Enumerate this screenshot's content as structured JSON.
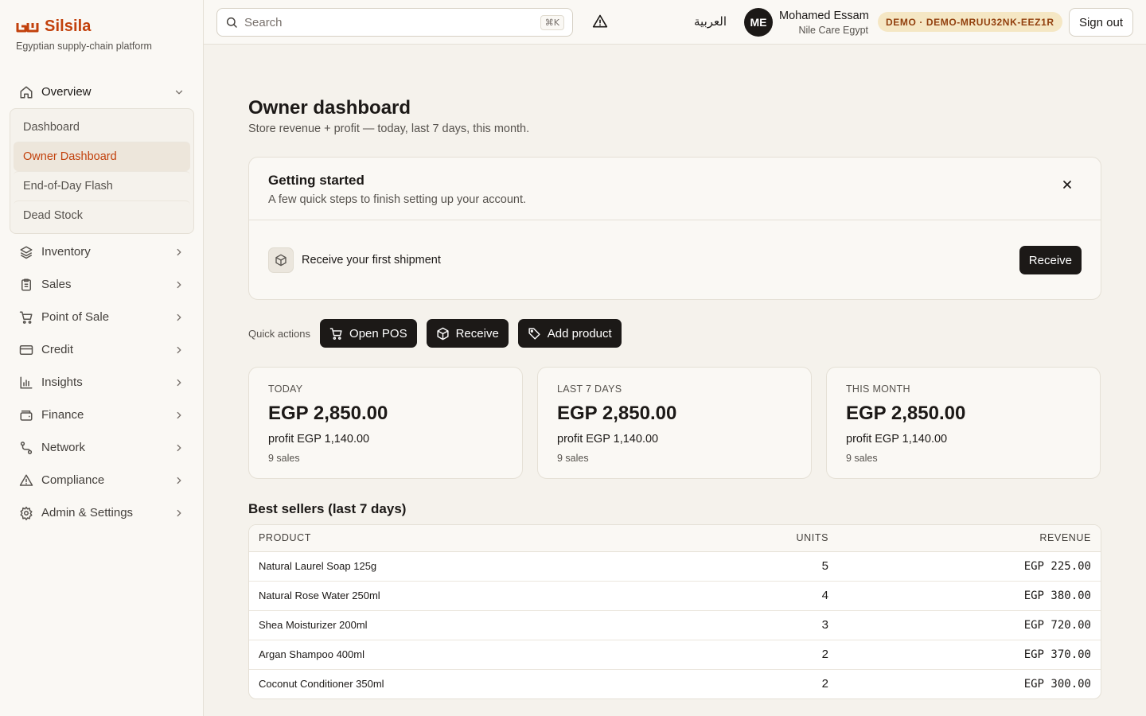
{
  "brand": {
    "name": "Silsila",
    "tagline": "Egyptian supply-chain platform",
    "color": "#c2410c"
  },
  "sidebar": {
    "overview": {
      "label": "Overview",
      "subitems": [
        "Dashboard",
        "Owner Dashboard",
        "End-of-Day Flash",
        "Dead Stock"
      ],
      "active": "Owner Dashboard"
    },
    "items": [
      {
        "label": "Inventory",
        "icon": "layers-icon"
      },
      {
        "label": "Sales",
        "icon": "clipboard-icon"
      },
      {
        "label": "Point of Sale",
        "icon": "cart-icon"
      },
      {
        "label": "Credit",
        "icon": "credit-card-icon"
      },
      {
        "label": "Insights",
        "icon": "bar-chart-icon"
      },
      {
        "label": "Finance",
        "icon": "wallet-icon"
      },
      {
        "label": "Network",
        "icon": "route-icon"
      },
      {
        "label": "Compliance",
        "icon": "warning-icon"
      },
      {
        "label": "Admin & Settings",
        "icon": "gear-icon"
      }
    ]
  },
  "topbar": {
    "search_placeholder": "Search",
    "shortcut": "⌘K",
    "language": "العربية",
    "user": {
      "initials": "ME",
      "name": "Mohamed Essam",
      "org": "Nile Care Egypt"
    },
    "demo_badge": "DEMO · DEMO-MRUU32NK-EEZ1R",
    "sign_out": "Sign out"
  },
  "page": {
    "title": "Owner dashboard",
    "subtitle": "Store revenue + profit — today, last 7 days, this month."
  },
  "getting_started": {
    "title": "Getting started",
    "subtitle": "A few quick steps to finish setting up your account.",
    "step": "Receive your first shipment",
    "action": "Receive"
  },
  "quick_actions": {
    "label": "Quick actions",
    "buttons": [
      "Open POS",
      "Receive",
      "Add product"
    ]
  },
  "stats": [
    {
      "label": "TODAY",
      "revenue": "EGP 2,850.00",
      "profit": "profit EGP 1,140.00",
      "sales": "9 sales"
    },
    {
      "label": "LAST 7 DAYS",
      "revenue": "EGP 2,850.00",
      "profit": "profit EGP 1,140.00",
      "sales": "9 sales"
    },
    {
      "label": "THIS MONTH",
      "revenue": "EGP 2,850.00",
      "profit": "profit EGP 1,140.00",
      "sales": "9 sales"
    }
  ],
  "best_sellers": {
    "title": "Best sellers (last 7 days)",
    "columns": [
      "PRODUCT",
      "UNITS",
      "REVENUE"
    ],
    "rows": [
      [
        "Natural Laurel Soap 125g",
        "5",
        "EGP 225.00"
      ],
      [
        "Natural Rose Water 250ml",
        "4",
        "EGP 380.00"
      ],
      [
        "Shea Moisturizer 200ml",
        "3",
        "EGP 720.00"
      ],
      [
        "Argan Shampoo 400ml",
        "2",
        "EGP 370.00"
      ],
      [
        "Coconut Conditioner 350ml",
        "2",
        "EGP 300.00"
      ]
    ]
  }
}
